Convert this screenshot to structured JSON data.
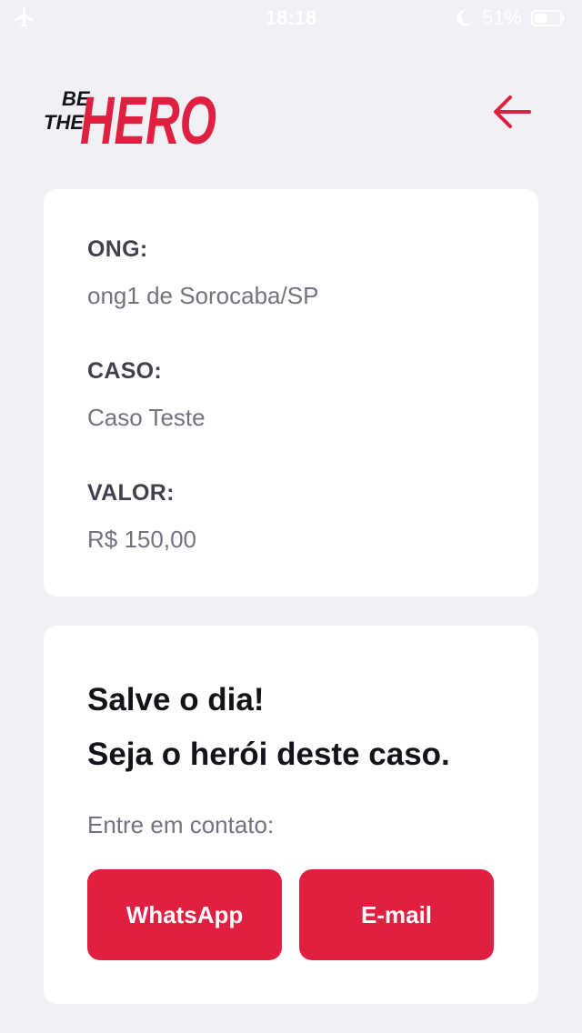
{
  "status_bar": {
    "time": "18:18",
    "battery": "51%",
    "icons": [
      "airplane-icon",
      "moon-icon",
      "battery-icon"
    ]
  },
  "header": {
    "logo_text_small_1": "BE",
    "logo_text_small_2": "THE",
    "logo_text_big": "HERO",
    "back_icon": "arrow-left-icon"
  },
  "incident": {
    "ong_label": "ONG:",
    "ong_value": "ong1 de Sorocaba/SP",
    "case_label": "CASO:",
    "case_value": "Caso Teste",
    "value_label": "VALOR:",
    "value_value": "R$ 150,00"
  },
  "contact": {
    "title_line1": "Salve o dia!",
    "title_line2": "Seja o herói deste caso.",
    "description": "Entre em contato:",
    "whatsapp_label": "WhatsApp",
    "email_label": "E-mail"
  },
  "colors": {
    "brand_red": "#e02041",
    "background": "#f0f0f5",
    "card": "#ffffff",
    "label_text": "#41414d",
    "value_text": "#737380",
    "heading_text": "#13131a"
  }
}
